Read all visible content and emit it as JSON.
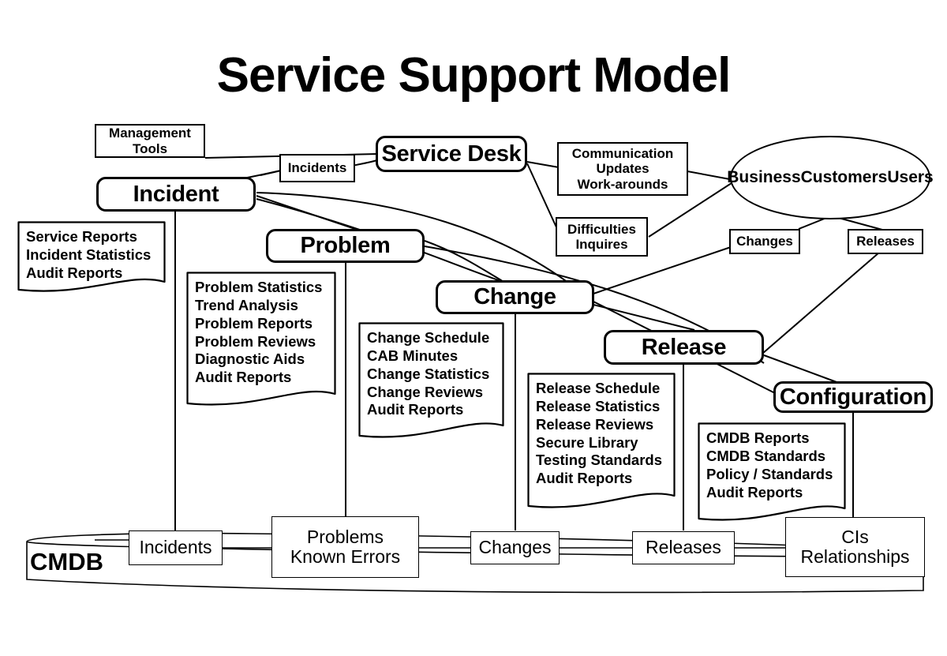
{
  "title": "Service Support Model",
  "processes": {
    "service_desk": "Service Desk",
    "incident": "Incident",
    "problem": "Problem",
    "change": "Change",
    "release": "Release",
    "configuration": "Configuration"
  },
  "actor": {
    "line1": "Business",
    "line2": "Customers",
    "line3": "Users"
  },
  "flows": {
    "management_tools": "Management\nTools",
    "incidents_top": "Incidents",
    "communication": "Communication\nUpdates\nWork-arounds",
    "difficulties": "Difficulties\nInquires",
    "changes_top": "Changes",
    "releases_top": "Releases"
  },
  "outputs": {
    "incident": "Service Reports\nIncident Statistics\nAudit Reports",
    "problem": "Problem Statistics\nTrend Analysis\nProblem Reports\nProblem Reviews\nDiagnostic Aids\nAudit Reports",
    "change": "Change Schedule\nCAB Minutes\nChange Statistics\nChange Reviews\nAudit Reports",
    "release": "Release Schedule\nRelease Statistics\nRelease Reviews\nSecure Library\nTesting Standards\nAudit Reports",
    "configuration": "CMDB Reports\nCMDB Standards\nPolicy / Standards\nAudit Reports"
  },
  "cmdb": {
    "label": "CMDB",
    "items": [
      "Incidents",
      "Problems\nKnown Errors",
      "Changes",
      "Releases",
      "CIs\nRelationships"
    ]
  },
  "colors": {
    "stroke": "#000000",
    "background": "#ffffff"
  }
}
